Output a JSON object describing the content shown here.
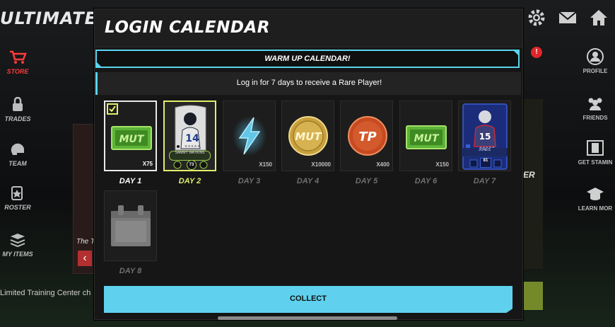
{
  "background": {
    "app_title": "ULTIMATE",
    "left_nav": [
      {
        "label": "STORE",
        "icon": "cart-icon"
      },
      {
        "label": "TRADES",
        "icon": "trades-icon"
      },
      {
        "label": "TEAM",
        "icon": "helmet-icon"
      },
      {
        "label": "ROSTER",
        "icon": "cards-icon"
      },
      {
        "label": "MY ITEMS",
        "icon": "stack-icon"
      }
    ],
    "right_nav": [
      {
        "label": "PROFILE",
        "icon": "profile-icon"
      },
      {
        "label": "FRIENDS",
        "icon": "friends-icon"
      },
      {
        "label": "GET STAMIN",
        "icon": "film-icon"
      },
      {
        "label": "LEARN MOR",
        "icon": "grad-cap-icon"
      }
    ],
    "ticker": "Limited Training Center ch",
    "panel_label_left": "The T",
    "panel_label_right": "ER",
    "alert_badge": "!"
  },
  "modal": {
    "title": "LOGIN CALENDAR",
    "banner": "WARM UP CALENDAR!",
    "subtitle": "Log in for 7 days to receive a Rare Player!",
    "collect_label": "COLLECT"
  },
  "days": [
    {
      "label": "DAY 1",
      "qty": "X75",
      "reward_icon": "mut-coin-bill-icon",
      "state": "claimed"
    },
    {
      "label": "DAY 2",
      "qty": "",
      "reward_icon": "player-card-icon",
      "state": "current",
      "card_name": "SAMMY WATKINS",
      "card_ovr": "73"
    },
    {
      "label": "DAY 3",
      "qty": "X150",
      "reward_icon": "lightning-icon",
      "state": "locked"
    },
    {
      "label": "DAY 4",
      "qty": "X10000",
      "reward_icon": "gold-coin-icon",
      "state": "locked"
    },
    {
      "label": "DAY 5",
      "qty": "X400",
      "reward_icon": "training-points-icon",
      "state": "locked"
    },
    {
      "label": "DAY 6",
      "qty": "X150",
      "reward_icon": "mut-coin-bill-icon",
      "state": "locked"
    },
    {
      "label": "DAY 7",
      "qty": "",
      "reward_icon": "rare-player-card-icon",
      "state": "locked",
      "card_name": "JONES",
      "card_ovr": "81"
    },
    {
      "label": "DAY 8",
      "qty": "",
      "reward_icon": "calendar-icon",
      "state": "locked"
    }
  ],
  "colors": {
    "accent_cyan": "#5fd1ee",
    "current_day_yellow": "#e2ef6a",
    "store_red": "#ff3b3b"
  }
}
